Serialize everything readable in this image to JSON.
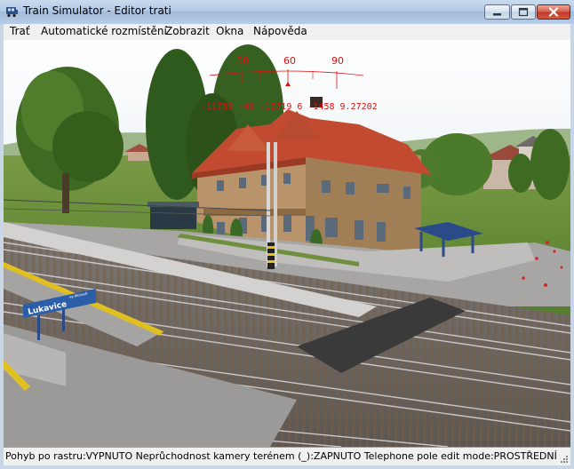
{
  "window": {
    "title": "Train Simulator - Editor trati"
  },
  "menu": {
    "items": [
      "Trať",
      "Automatické rozmístění",
      "Zobrazit",
      "Okna",
      "Nápověda"
    ]
  },
  "overlay": {
    "compass_labels": [
      "30",
      "60",
      "90"
    ],
    "coordinate_readout": "-11789 -49 -12719 6 -1458 9.27202"
  },
  "scene": {
    "station_sign": {
      "name": "Lukavice",
      "subtitle": "na Moravě"
    }
  },
  "status": {
    "text": "Pohyb po rastru:VYPNUTO Neprůchodnost kamery terénem (_):ZAPNUTO Telephone pole edit mode:PROSTŘEDNÍ"
  },
  "colors": {
    "titlebar": "#b3cae4",
    "close_button": "#c0392b",
    "menubar": "#f0f0f0",
    "overlay_red": "#e01010",
    "sign_blue": "#2a5ea8"
  }
}
